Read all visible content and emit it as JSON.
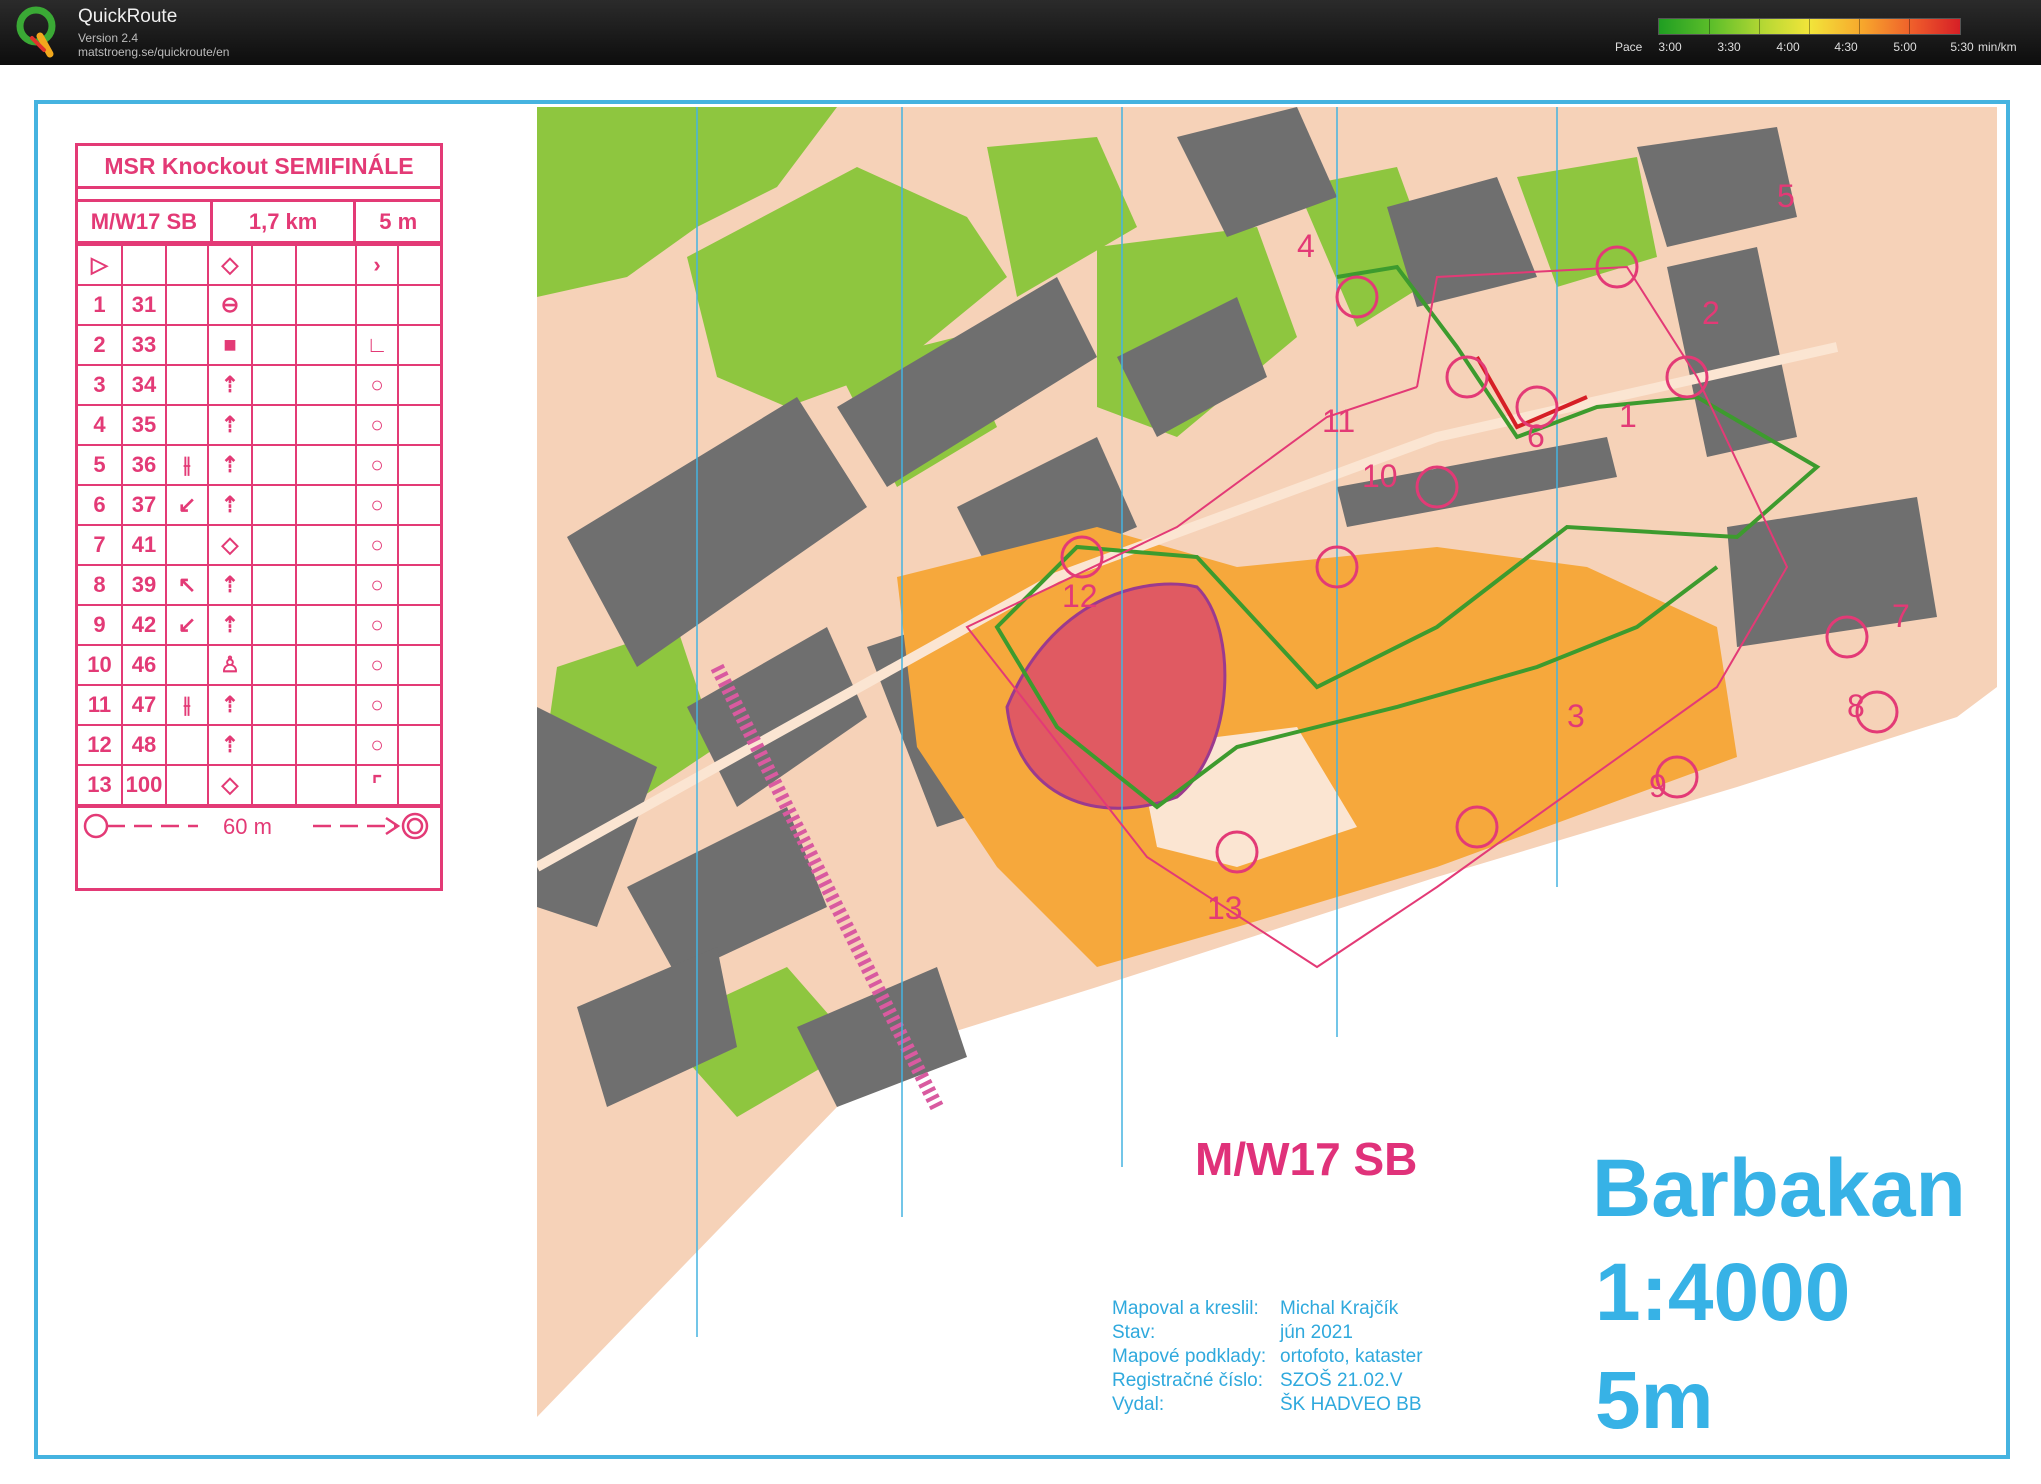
{
  "app": {
    "name": "QuickRoute",
    "version": "Version 2.4",
    "url": "matstroeng.se/quickroute/en"
  },
  "pace_legend": {
    "label": "Pace",
    "ticks": [
      "3:00",
      "3:30",
      "4:00",
      "4:30",
      "5:00",
      "5:30"
    ],
    "unit": "min/km",
    "colors": [
      "#1f9e22",
      "#b7d834",
      "#f2e53a",
      "#f7a52c",
      "#ee5a2b",
      "#d61f26"
    ]
  },
  "control_card": {
    "title": "MSR Knockout SEMIFINÁLE",
    "course": "M/W17 SB",
    "length": "1,7 km",
    "climb": "5 m",
    "controls": [
      {
        "num": "1",
        "code": "31"
      },
      {
        "num": "2",
        "code": "33"
      },
      {
        "num": "3",
        "code": "34"
      },
      {
        "num": "4",
        "code": "35"
      },
      {
        "num": "5",
        "code": "36"
      },
      {
        "num": "6",
        "code": "37"
      },
      {
        "num": "7",
        "code": "41"
      },
      {
        "num": "8",
        "code": "39"
      },
      {
        "num": "9",
        "code": "42"
      },
      {
        "num": "10",
        "code": "46"
      },
      {
        "num": "11",
        "code": "47"
      },
      {
        "num": "12",
        "code": "48"
      },
      {
        "num": "13",
        "code": "100"
      }
    ],
    "finish_distance": "60 m"
  },
  "map": {
    "class_label": "M/W17 SB",
    "name": "Barbakan",
    "scale": "1:4000",
    "contour": "5m",
    "control_numbers": [
      "1",
      "2",
      "3",
      "4",
      "5",
      "6",
      "7",
      "8",
      "9",
      "10",
      "11",
      "12",
      "13"
    ],
    "credits": [
      {
        "key": "Mapoval a kreslil:",
        "value": "Michal Krajčík"
      },
      {
        "key": "Stav:",
        "value": "jún 2021"
      },
      {
        "key": "Mapové podklady:",
        "value": "ortofoto, kataster"
      },
      {
        "key": "Registračné číslo:",
        "value": "SZOŠ 21.02.V"
      },
      {
        "key": "Vydal:",
        "value": "ŠK HADVEO BB"
      }
    ],
    "colors": {
      "building": "#6f6f6f",
      "green": "#8ec63f",
      "open_land": "#f6a83c",
      "paved": "#f6d2b8",
      "course": "#e33a76",
      "magnetic_north": "#45b3e0"
    }
  }
}
